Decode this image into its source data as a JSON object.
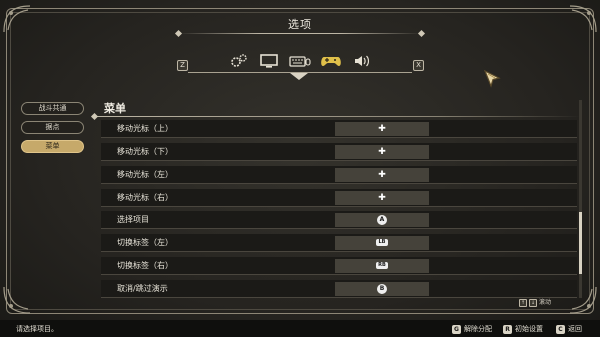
{
  "header": {
    "title": "选项",
    "left_key": "Z",
    "right_key": "X",
    "tabs": [
      {
        "icon": "gears-icon",
        "active": false
      },
      {
        "icon": "monitor-icon",
        "active": false
      },
      {
        "icon": "keyboard-icon",
        "active": false
      },
      {
        "icon": "gamepad-icon",
        "active": true
      },
      {
        "icon": "speaker-icon",
        "active": false
      }
    ]
  },
  "sidebar": {
    "items": [
      {
        "label": "战斗共通",
        "active": false
      },
      {
        "label": "据点",
        "active": false
      },
      {
        "label": "菜单",
        "active": true
      }
    ]
  },
  "section": {
    "title": "菜单",
    "rows": [
      {
        "label": "移动光标（上）",
        "glyph": "✚",
        "glyph_type": "dpad"
      },
      {
        "label": "移动光标（下）",
        "glyph": "✚",
        "glyph_type": "dpad"
      },
      {
        "label": "移动光标（左）",
        "glyph": "✚",
        "glyph_type": "dpad"
      },
      {
        "label": "移动光标（右）",
        "glyph": "✚",
        "glyph_type": "dpad"
      },
      {
        "label": "选择项目",
        "glyph": "A",
        "glyph_type": "circle"
      },
      {
        "label": "切换标签（左）",
        "glyph": "LB",
        "glyph_type": "pill"
      },
      {
        "label": "切换标签（右）",
        "glyph": "RB",
        "glyph_type": "pill"
      },
      {
        "label": "取消/跳过演示",
        "glyph": "B",
        "glyph_type": "circle"
      }
    ]
  },
  "scroll_hint": {
    "key_up": "↑",
    "key_down": "↓",
    "label": "滚动"
  },
  "footer": {
    "message": "请选择项目。",
    "actions": [
      {
        "key": "G",
        "label": "解除分配"
      },
      {
        "key": "R",
        "label": "初始设置"
      },
      {
        "key": "C",
        "label": "返回"
      }
    ]
  },
  "colors": {
    "accent": "#c6a96a",
    "background": "#26241f",
    "row": "#1b1a17",
    "cell": "#45423a"
  }
}
